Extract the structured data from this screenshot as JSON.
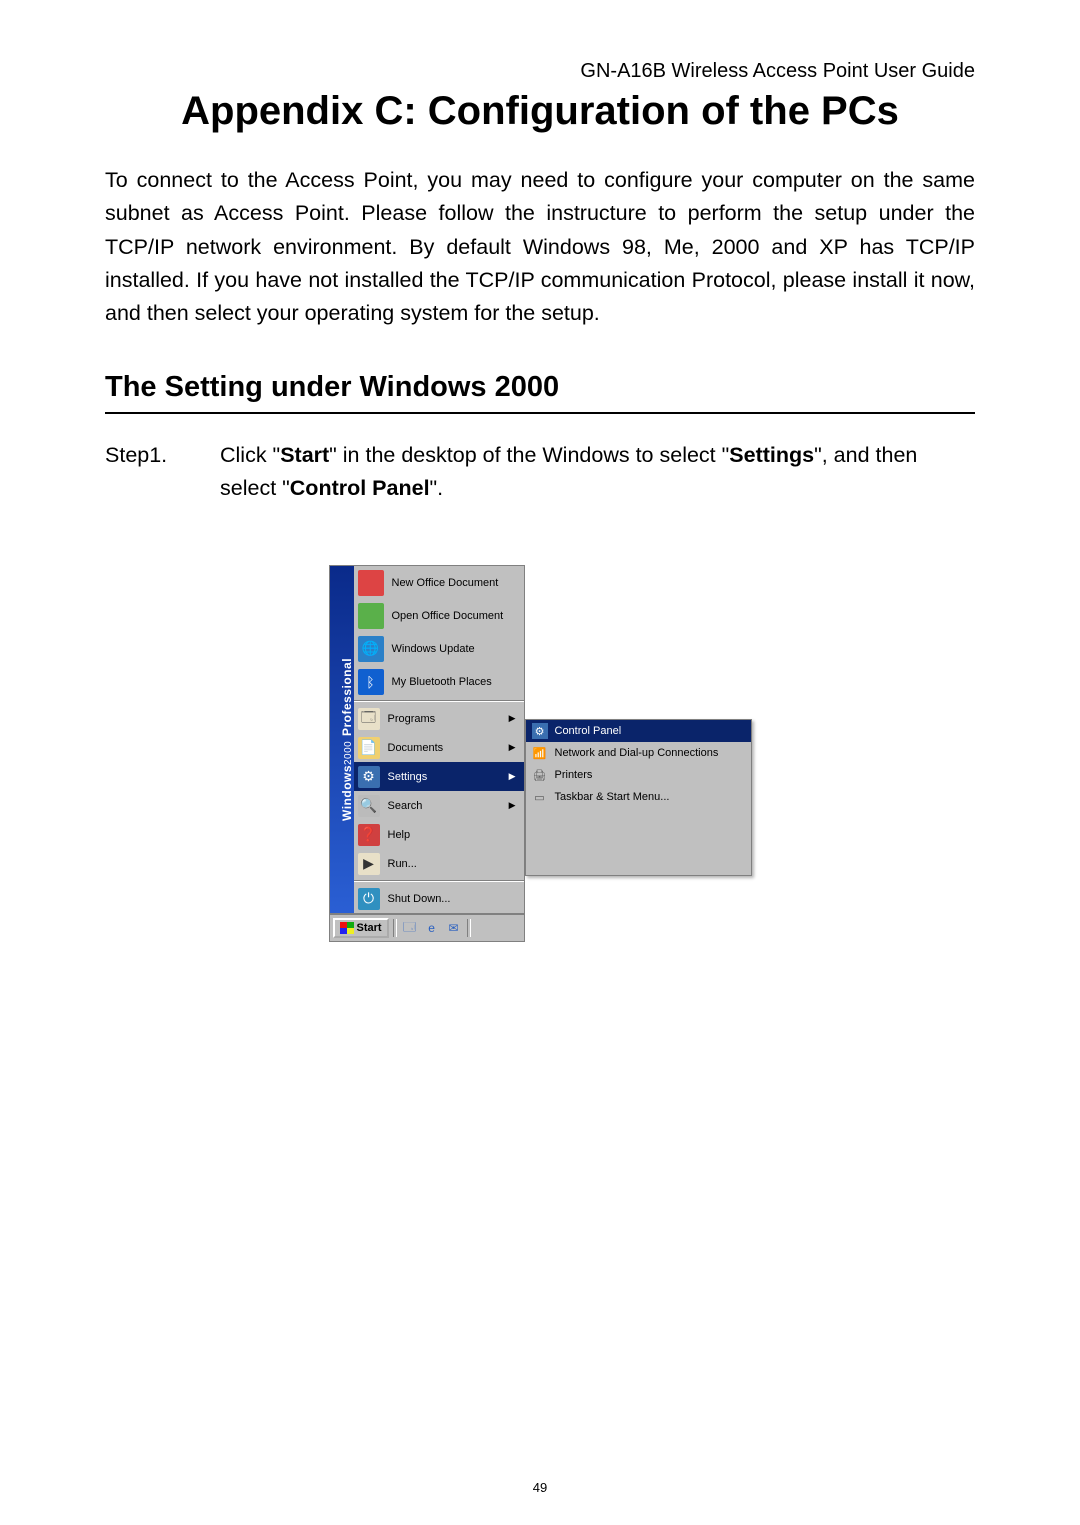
{
  "header": "GN-A16B Wireless Access Point User Guide",
  "title": "Appendix C: Configuration of the PCs",
  "intro": "To connect to the Access Point, you may need to configure your computer on the same subnet as Access Point. Please follow the instructure to perform the setup under the TCP/IP network environment. By default Windows 98, Me, 2000 and XP has TCP/IP installed. If you have not installed the TCP/IP communication Protocol, please install it now, and then select your operating system for the setup.",
  "section_title": "The Setting under Windows 2000",
  "step": {
    "label": "Step1.",
    "pre": "Click \"",
    "b1": "Start",
    "mid1": "\" in the desktop of the Windows to select \"",
    "b2": "Settings",
    "mid2": "\", and then select \"",
    "b3": "Control Panel",
    "post": "\"."
  },
  "start_menu": {
    "sidebar_brand": "Windows",
    "sidebar_ver": "2000",
    "sidebar_edition": "Professional",
    "top_items": [
      "New Office Document",
      "Open Office Document",
      "Windows Update",
      "My Bluetooth Places"
    ],
    "main_items": [
      {
        "label": "Programs",
        "arrow": true,
        "highlight": false
      },
      {
        "label": "Documents",
        "arrow": true,
        "highlight": false
      },
      {
        "label": "Settings",
        "arrow": true,
        "highlight": true
      },
      {
        "label": "Search",
        "arrow": true,
        "highlight": false
      },
      {
        "label": "Help",
        "arrow": false,
        "highlight": false
      },
      {
        "label": "Run...",
        "arrow": false,
        "highlight": false
      }
    ],
    "shutdown": "Shut Down...",
    "start_label": "Start"
  },
  "submenu": {
    "items": [
      {
        "label": "Control Panel",
        "highlight": true
      },
      {
        "label": "Network and Dial-up Connections",
        "highlight": false
      },
      {
        "label": "Printers",
        "highlight": false
      },
      {
        "label": "Taskbar & Start Menu...",
        "highlight": false
      }
    ]
  },
  "page_number": "49"
}
